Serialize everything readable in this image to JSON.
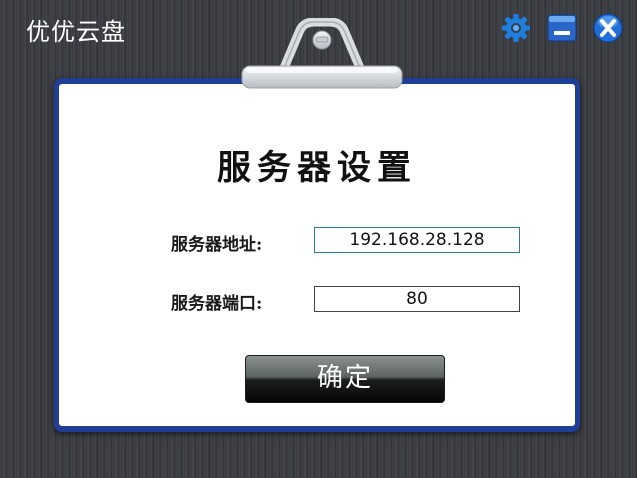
{
  "app": {
    "title": "优优云盘"
  },
  "window_controls": {
    "settings_icon": "gear-icon",
    "minimize_icon": "minimize-icon",
    "close_icon": "close-icon"
  },
  "dialog": {
    "title": "服务器设置",
    "address_label": "服务器地址:",
    "address_value": "192.168.28.128",
    "port_label": "服务器端口:",
    "port_value": "80",
    "confirm_label": "确定"
  },
  "colors": {
    "board_border": "#1f3f97",
    "settings_icon": "#1e7fe0",
    "minimize_icon": "#2a66c8",
    "close_icon": "#1f6fd6"
  }
}
